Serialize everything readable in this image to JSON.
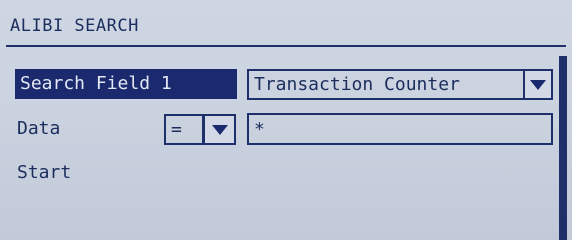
{
  "header": {
    "title": "ALIBI SEARCH"
  },
  "row1": {
    "label": "Search Field 1",
    "value": "Transaction Counter"
  },
  "row2": {
    "label": "Data",
    "operator": "=",
    "value": "*"
  },
  "row3": {
    "label": "Start"
  },
  "icons": {
    "dropdown": "triangle-down-icon"
  },
  "colors": {
    "background": "#c9d0de",
    "foreground": "#1b2a6e",
    "highlight_text": "#e4e8f4"
  }
}
